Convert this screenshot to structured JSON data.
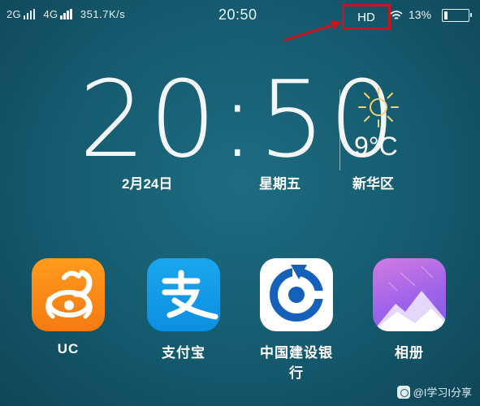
{
  "status_bar": {
    "network1": "2G",
    "network2": "4G",
    "speed": "351.7K/s",
    "time": "20:50",
    "hd_label": "HD",
    "battery_pct": "13%",
    "battery_level": 0.13
  },
  "lock_screen": {
    "time": "20:50",
    "date": "2月24日",
    "weekday": "星期五",
    "temperature": "9°C",
    "district": "新华区",
    "weather_icon": "sun-icon"
  },
  "apps": [
    {
      "label": "UC",
      "icon": "uc-browser-icon"
    },
    {
      "label": "支付宝",
      "icon": "alipay-icon"
    },
    {
      "label": "中国建设银行",
      "icon": "ccb-bank-icon"
    },
    {
      "label": "相册",
      "icon": "gallery-icon"
    }
  ],
  "watermark": {
    "text": "@I学习I分享"
  },
  "colors": {
    "background": "#155a6e",
    "highlight_box": "#c8141e",
    "uc_orange": "#f57a12",
    "alipay_blue": "#0d8fe0",
    "ccb_blue": "#1560b8",
    "gallery_purple": "#9f63ea"
  }
}
